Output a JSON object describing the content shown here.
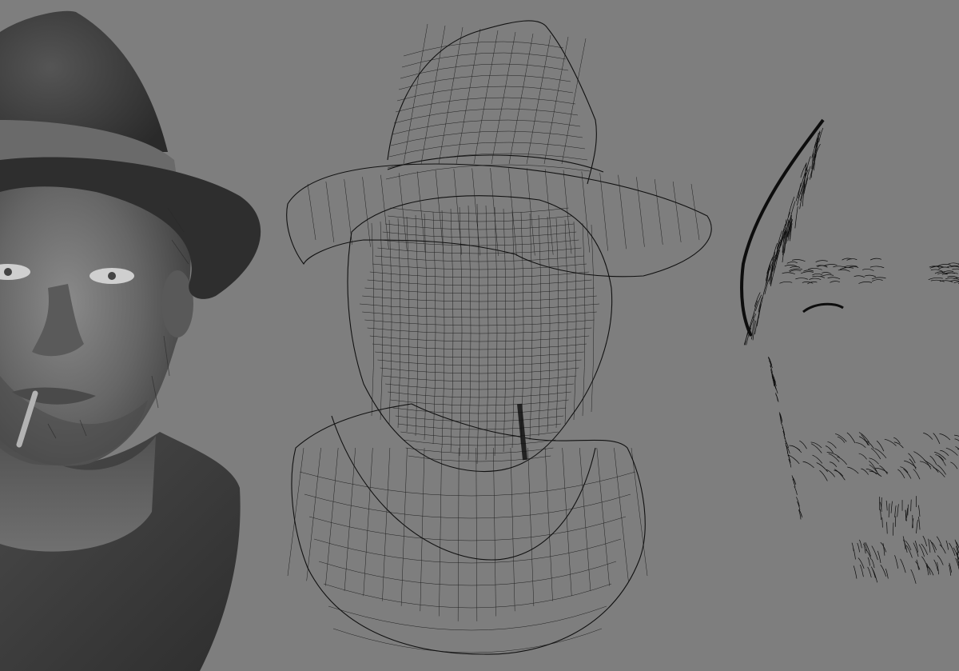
{
  "viewport": {
    "background": "#7e7e7e",
    "panels": [
      {
        "id": "shaded",
        "render_mode": "smooth-shaded",
        "subject": "head-with-fedora-and-cigarette"
      },
      {
        "id": "wireframe",
        "render_mode": "wireframe",
        "subject": "head-with-fedora-and-cigarette"
      },
      {
        "id": "hair-guides",
        "render_mode": "hair-curves-only",
        "subject": "eyebrows-sideburn-stubble"
      }
    ],
    "colors": {
      "background": "#7e7e7e",
      "shaded_skin": "#5c5c5c",
      "shaded_hat": "#3e3e3e",
      "wire_line": "#111111"
    }
  }
}
